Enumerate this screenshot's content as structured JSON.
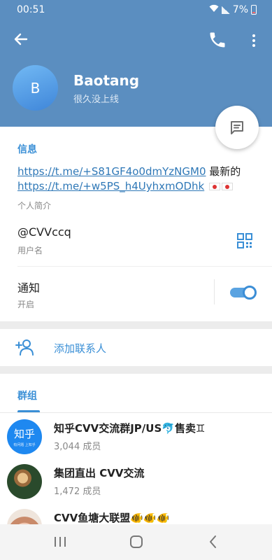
{
  "status_bar": {
    "time": "00:51",
    "battery": "7%"
  },
  "header": {
    "avatar_initial": "B",
    "name": "Baotang",
    "last_seen": "很久没上线",
    "color": "#5b8ec0"
  },
  "info": {
    "section_title": "信息",
    "bio": {
      "link1": "https://t.me/+S81GF4o0dmYzNGM0",
      "middle_text": " 最新的 ",
      "link2": "https://t.me/+w5PS_h4UyhxmODhk",
      "label": "个人简介"
    },
    "username": {
      "value": "@CVVccq",
      "label": "用户名"
    },
    "notifications": {
      "label": "通知",
      "state": "开启",
      "enabled": true
    }
  },
  "actions": {
    "add_contact": "添加联系人"
  },
  "groups": {
    "tab_label": "群组",
    "items": [
      {
        "name": "知乎CVV交流群JP/US🐬售卖♊",
        "members": "3,044 成员",
        "avatar_text": "知乎",
        "avatar_subtext": "有问题 上知乎"
      },
      {
        "name": "集团直出 CVV交流",
        "members": "1,472 成员"
      },
      {
        "name": "CVV鱼塘大联盟🐠🐠🐠",
        "members": ""
      }
    ]
  },
  "icons": {
    "back": "arrow-left-icon",
    "call": "phone-icon",
    "more": "more-vertical-icon",
    "message": "message-icon",
    "qr": "qr-code-icon",
    "add_contact": "add-person-icon"
  },
  "accent_color": "#3a8fd6"
}
